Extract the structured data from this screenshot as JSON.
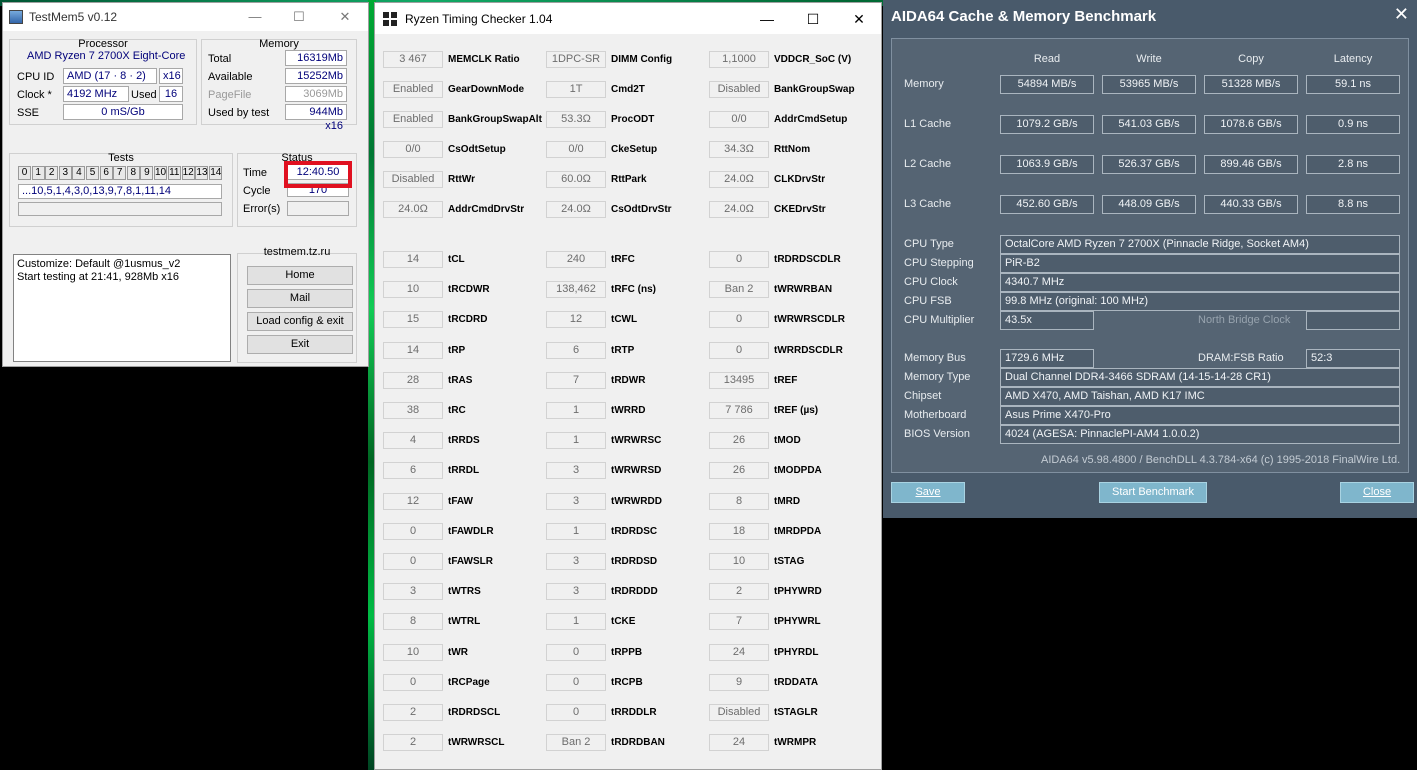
{
  "testmem": {
    "title": "TestMem5 v0.12",
    "processor_label": "Processor",
    "cpu_name": "AMD Ryzen 7 2700X Eight-Core",
    "cpuid_label": "CPU ID",
    "cpuid_value": "AMD  (17 · 8 · 2)",
    "cpuid_threads": "x16",
    "clock_label": "Clock *",
    "clock_value": "4192 MHz",
    "used_label": "Used",
    "used_value": "16",
    "sse_label": "SSE",
    "sse_value": "0 mS/Gb",
    "memory_label": "Memory",
    "total_label": "Total",
    "total_value": "16319Mb",
    "available_label": "Available",
    "available_value": "15252Mb",
    "pagefile_label": "PageFile",
    "pagefile_value": "3069Mb",
    "usedbytest_label": "Used by test",
    "usedbytest_value": "944Mb x16",
    "tests_label": "Tests",
    "test_numbers": [
      "0",
      "1",
      "2",
      "3",
      "4",
      "5",
      "6",
      "7",
      "8",
      "9",
      "10",
      "11",
      "12",
      "13",
      "14"
    ],
    "test_sequence": "...10,5,1,4,3,0,13,9,7,8,1,11,14",
    "status_label": "Status",
    "time_label": "Time",
    "time_value": "12:40.50",
    "cycle_label": "Cycle",
    "cycle_value": "170",
    "errors_label": "Error(s)",
    "errors_value": "",
    "log_line1": "Customize: Default @1usmus_v2",
    "log_line2": "Start testing at 21:41, 928Mb x16",
    "site_label": "testmem.tz.ru",
    "btn_home": "Home",
    "btn_mail": "Mail",
    "btn_load": "Load config & exit",
    "btn_exit": "Exit"
  },
  "rtc": {
    "title": "Ryzen Timing Checker 1.04",
    "rows": [
      [
        {
          "v": "3 467",
          "n": "MEMCLK Ratio"
        },
        {
          "v": "1DPC-SR",
          "n": "DIMM Config"
        },
        {
          "v": "1,1000",
          "n": "VDDCR_SoC (V)"
        }
      ],
      [
        {
          "v": "Enabled",
          "n": "GearDownMode"
        },
        {
          "v": "1T",
          "n": "Cmd2T"
        },
        {
          "v": "Disabled",
          "n": "BankGroupSwap"
        }
      ],
      [
        {
          "v": "Enabled",
          "n": "BankGroupSwapAlt"
        },
        {
          "v": "53.3Ω",
          "n": "ProcODT"
        },
        {
          "v": "0/0",
          "n": "AddrCmdSetup"
        }
      ],
      [
        {
          "v": "0/0",
          "n": "CsOdtSetup"
        },
        {
          "v": "0/0",
          "n": "CkeSetup"
        },
        {
          "v": "34.3Ω",
          "n": "RttNom"
        }
      ],
      [
        {
          "v": "Disabled",
          "n": "RttWr"
        },
        {
          "v": "60.0Ω",
          "n": "RttPark"
        },
        {
          "v": "24.0Ω",
          "n": "CLKDrvStr"
        }
      ],
      [
        {
          "v": "24.0Ω",
          "n": "AddrCmdDrvStr"
        },
        {
          "v": "24.0Ω",
          "n": "CsOdtDrvStr"
        },
        {
          "v": "24.0Ω",
          "n": "CKEDrvStr"
        }
      ]
    ],
    "timings": [
      [
        {
          "v": "14",
          "n": "tCL"
        },
        {
          "v": "240",
          "n": "tRFC"
        },
        {
          "v": "0",
          "n": "tRDRDSCDLR"
        }
      ],
      [
        {
          "v": "10",
          "n": "tRCDWR"
        },
        {
          "v": "138,462",
          "n": "tRFC (ns)"
        },
        {
          "v": "Ban 2",
          "n": "tWRWRBAN"
        }
      ],
      [
        {
          "v": "15",
          "n": "tRCDRD"
        },
        {
          "v": "12",
          "n": "tCWL"
        },
        {
          "v": "0",
          "n": "tWRWRSCDLR"
        }
      ],
      [
        {
          "v": "14",
          "n": "tRP"
        },
        {
          "v": "6",
          "n": "tRTP"
        },
        {
          "v": "0",
          "n": "tWRRDSCDLR"
        }
      ],
      [
        {
          "v": "28",
          "n": "tRAS"
        },
        {
          "v": "7",
          "n": "tRDWR"
        },
        {
          "v": "13495",
          "n": "tREF"
        }
      ],
      [
        {
          "v": "38",
          "n": "tRC"
        },
        {
          "v": "1",
          "n": "tWRRD"
        },
        {
          "v": "7 786",
          "n": "tREF (µs)"
        }
      ],
      [
        {
          "v": "4",
          "n": "tRRDS"
        },
        {
          "v": "1",
          "n": "tWRWRSC"
        },
        {
          "v": "26",
          "n": "tMOD"
        }
      ],
      [
        {
          "v": "6",
          "n": "tRRDL"
        },
        {
          "v": "3",
          "n": "tWRWRSD"
        },
        {
          "v": "26",
          "n": "tMODPDA"
        }
      ],
      [
        {
          "v": "12",
          "n": "tFAW"
        },
        {
          "v": "3",
          "n": "tWRWRDD"
        },
        {
          "v": "8",
          "n": "tMRD"
        }
      ],
      [
        {
          "v": "0",
          "n": "tFAWDLR"
        },
        {
          "v": "1",
          "n": "tRDRDSC"
        },
        {
          "v": "18",
          "n": "tMRDPDA"
        }
      ],
      [
        {
          "v": "0",
          "n": "tFAWSLR"
        },
        {
          "v": "3",
          "n": "tRDRDSD"
        },
        {
          "v": "10",
          "n": "tSTAG"
        }
      ],
      [
        {
          "v": "3",
          "n": "tWTRS"
        },
        {
          "v": "3",
          "n": "tRDRDDD"
        },
        {
          "v": "2",
          "n": "tPHYWRD"
        }
      ],
      [
        {
          "v": "8",
          "n": "tWTRL"
        },
        {
          "v": "1",
          "n": "tCKE"
        },
        {
          "v": "7",
          "n": "tPHYWRL"
        }
      ],
      [
        {
          "v": "10",
          "n": "tWR"
        },
        {
          "v": "0",
          "n": "tRPPB"
        },
        {
          "v": "24",
          "n": "tPHYRDL"
        }
      ],
      [
        {
          "v": "0",
          "n": "tRCPage"
        },
        {
          "v": "0",
          "n": "tRCPB"
        },
        {
          "v": "9",
          "n": "tRDDATA"
        }
      ],
      [
        {
          "v": "2",
          "n": "tRDRDSCL"
        },
        {
          "v": "0",
          "n": "tRRDDLR"
        },
        {
          "v": "Disabled",
          "n": "tSTAGLR"
        }
      ],
      [
        {
          "v": "2",
          "n": "tWRWRSCL"
        },
        {
          "v": "Ban 2",
          "n": "tRDRDBAN"
        },
        {
          "v": "24",
          "n": "tWRMPR"
        }
      ]
    ]
  },
  "aida": {
    "title": "AIDA64 Cache & Memory Benchmark",
    "headers": [
      "Read",
      "Write",
      "Copy",
      "Latency"
    ],
    "bench": [
      {
        "label": "Memory",
        "vals": [
          "54894 MB/s",
          "53965 MB/s",
          "51328 MB/s",
          "59.1 ns"
        ]
      },
      {
        "label": "L1 Cache",
        "vals": [
          "1079.2 GB/s",
          "541.03 GB/s",
          "1078.6 GB/s",
          "0.9 ns"
        ]
      },
      {
        "label": "L2 Cache",
        "vals": [
          "1063.9 GB/s",
          "526.37 GB/s",
          "899.46 GB/s",
          "2.8 ns"
        ]
      },
      {
        "label": "L3 Cache",
        "vals": [
          "452.60 GB/s",
          "448.09 GB/s",
          "440.33 GB/s",
          "8.8 ns"
        ]
      }
    ],
    "cpu_type_label": "CPU Type",
    "cpu_type": "OctalCore AMD Ryzen 7 2700X  (Pinnacle Ridge, Socket AM4)",
    "cpu_stepping_label": "CPU Stepping",
    "cpu_stepping": "PiR-B2",
    "cpu_clock_label": "CPU Clock",
    "cpu_clock": "4340.7 MHz",
    "cpu_fsb_label": "CPU FSB",
    "cpu_fsb": "99.8 MHz  (original: 100 MHz)",
    "cpu_mult_label": "CPU Multiplier",
    "cpu_mult": "43.5x",
    "nb_clock_label": "North Bridge Clock",
    "nb_clock": "",
    "mem_bus_label": "Memory Bus",
    "mem_bus": "1729.6 MHz",
    "dram_fsb_label": "DRAM:FSB Ratio",
    "dram_fsb": "52:3",
    "mem_type_label": "Memory Type",
    "mem_type": "Dual Channel DDR4-3466 SDRAM  (14-15-14-28 CR1)",
    "chipset_label": "Chipset",
    "chipset": "AMD X470, AMD Taishan, AMD K17 IMC",
    "mobo_label": "Motherboard",
    "mobo": "Asus Prime X470-Pro",
    "bios_label": "BIOS Version",
    "bios": "4024  (AGESA: PinnaclePI-AM4 1.0.0.2)",
    "footer": "AIDA64 v5.98.4800 / BenchDLL 4.3.784-x64  (c) 1995-2018 FinalWire Ltd.",
    "btn_save": "Save",
    "btn_start": "Start Benchmark",
    "btn_close": "Close"
  }
}
